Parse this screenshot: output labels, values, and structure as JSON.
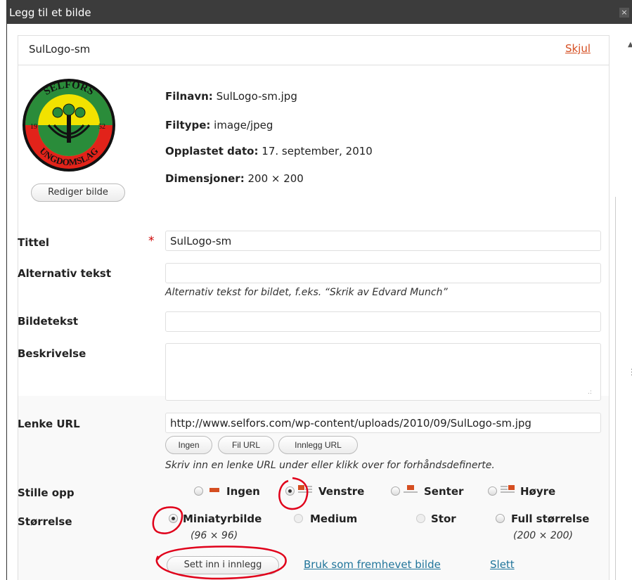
{
  "dialog": {
    "title": "Legg til et bilde",
    "close_glyph": "×"
  },
  "panel": {
    "name": "SulLogo-sm",
    "hide_link": "Skjul"
  },
  "logo": {
    "top_text": "SELFORS",
    "bottom_text": "UNGDOMSLAG",
    "year_left": "19",
    "year_right": "52"
  },
  "file": {
    "filename_label": "Filnavn:",
    "filename": "SulLogo-sm.jpg",
    "filetype_label": "Filtype:",
    "filetype": "image/jpeg",
    "uploaded_label": "Opplastet dato:",
    "uploaded": "17. september, 2010",
    "dimensions_label": "Dimensjoner:",
    "dimensions": "200 × 200"
  },
  "edit_button": "Rediger bilde",
  "form": {
    "title_label": "Tittel",
    "title_required": "*",
    "title_value": "SulLogo-sm",
    "alt_label": "Alternativ tekst",
    "alt_value": "",
    "alt_help": "Alternativ tekst for bildet, f.eks. “Skrik av Edvard Munch”",
    "caption_label": "Bildetekst",
    "caption_value": "",
    "description_label": "Beskrivelse",
    "description_value": "",
    "link_label": "Lenke URL",
    "link_value": "http://www.selfors.com/wp-content/uploads/2010/09/SulLogo-sm.jpg",
    "link_buttons": [
      "Ingen",
      "Fil URL",
      "Innlegg URL"
    ],
    "link_help": "Skriv inn en lenke URL under eller klikk over for forhåndsdefinerte."
  },
  "align": {
    "label": "Stille opp",
    "options": [
      "Ingen",
      "Venstre",
      "Senter",
      "Høyre"
    ],
    "selected": "Venstre"
  },
  "size": {
    "label": "Størrelse",
    "options": [
      {
        "name": "Miniatyrbilde",
        "dims": "(96 × 96)"
      },
      {
        "name": "Medium",
        "dims": ""
      },
      {
        "name": "Stor",
        "dims": ""
      },
      {
        "name": "Full størrelse",
        "dims": "(200 × 200)"
      }
    ],
    "selected": "Miniatyrbilde"
  },
  "actions": {
    "insert": "Sett inn i innlegg",
    "featured": "Bruk som fremhevet bilde",
    "delete": "Slett"
  },
  "colors": {
    "titlebar": "#3c3c3c",
    "link": "#21759b",
    "hide_link": "#d54e21",
    "annotation": "#e0001a",
    "required": "#cc0000"
  }
}
